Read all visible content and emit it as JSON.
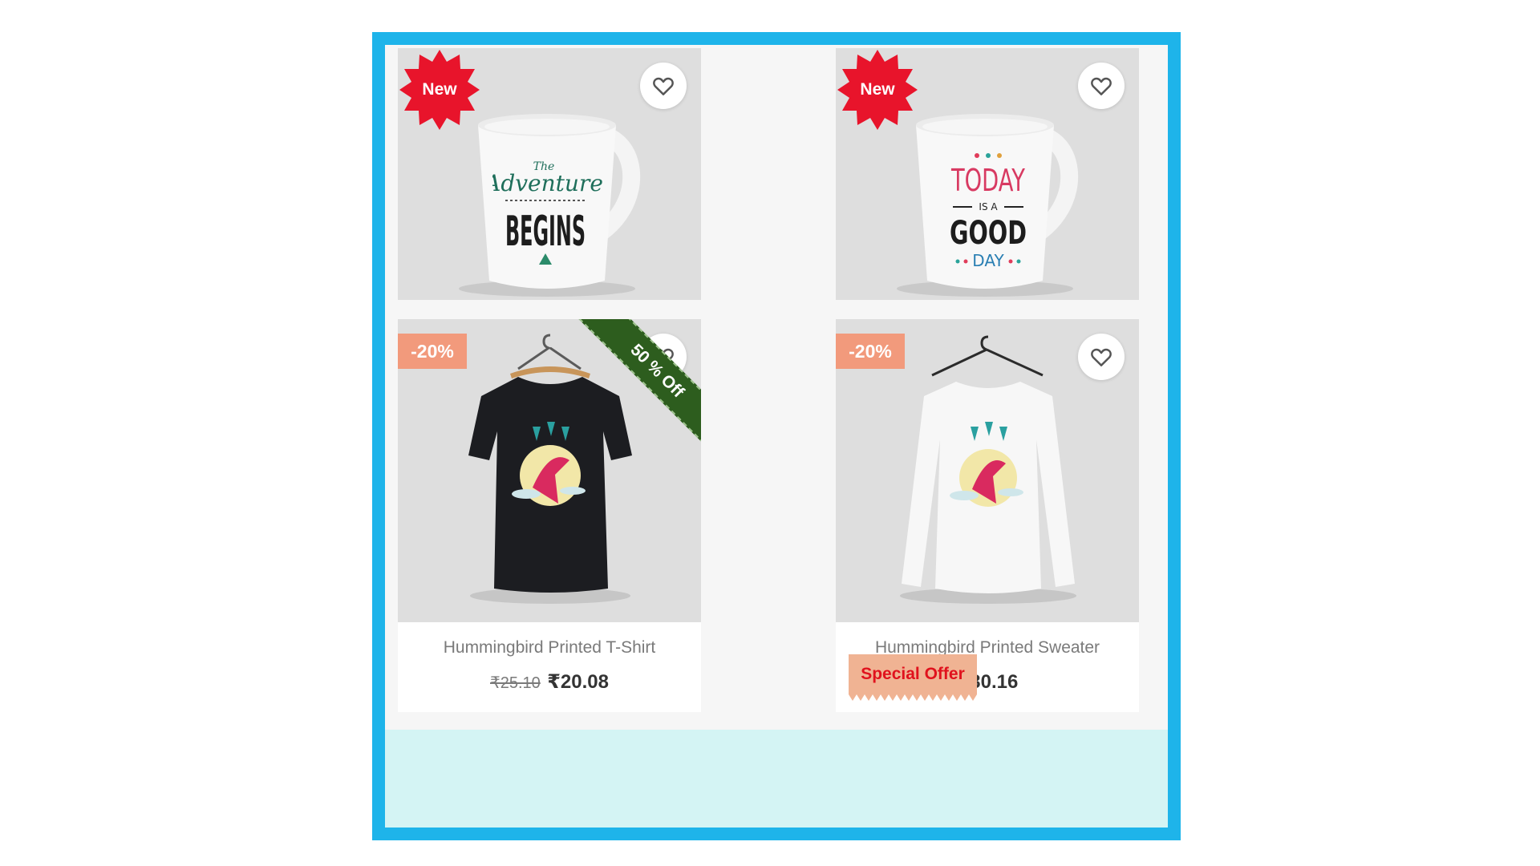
{
  "colors": {
    "frame_border": "#1eb4ea",
    "new_badge": "#e8142b",
    "discount_badge": "#f29a7c",
    "ribbon": "#2d5d1e",
    "special_offer_bg": "#f0b393",
    "special_offer_text": "#e0121d",
    "bottom_band": "#d4f4f4"
  },
  "products": [
    {
      "badge": "New",
      "badge_type": "new",
      "image": "mug-adventure",
      "mug_lines": [
        "The",
        "Adventure",
        "BEGINS"
      ]
    },
    {
      "badge": "New",
      "badge_type": "new",
      "image": "mug-today",
      "mug_lines": [
        "TODAY",
        "IS A",
        "GOOD",
        "DAY"
      ]
    },
    {
      "badge": "-20%",
      "badge_type": "discount",
      "ribbon": "50 % Off",
      "image": "black-tshirt",
      "title": "Hummingbird Printed T-Shirt",
      "old_price": "₹25.10",
      "price": "₹20.08"
    },
    {
      "badge": "-20%",
      "badge_type": "discount",
      "image": "white-sweater",
      "title": "Hummingbird Printed Sweater",
      "special_tag": "Special Offer",
      "price": "₹30.16"
    }
  ],
  "icons": {
    "wishlist": "heart-outline-icon"
  }
}
